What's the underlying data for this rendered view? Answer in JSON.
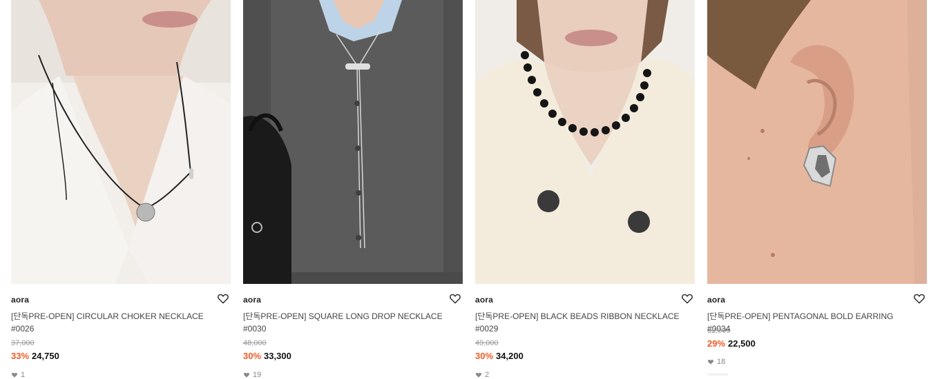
{
  "products": [
    {
      "brand": "aora",
      "name": "[단독PRE-OPEN] CIRCULAR CHOKER NECKLACE #0026",
      "original_price": "37,000",
      "discount": "33%",
      "sale_price": "24,750",
      "likes": "1",
      "image_icon": "necklace-photo"
    },
    {
      "brand": "aora",
      "name": "[단독PRE-OPEN] SQUARE LONG DROP NECKLACE #0030",
      "original_price": "48,000",
      "discount": "30%",
      "sale_price": "33,300",
      "likes": "19",
      "image_icon": "necklace-photo"
    },
    {
      "brand": "aora",
      "name": "[단독PRE-OPEN] BLACK BEADS RIBBON NECKLACE #0029",
      "original_price": "49,000",
      "discount": "30%",
      "sale_price": "34,200",
      "likes": "2",
      "image_icon": "necklace-photo"
    },
    {
      "brand": "aora",
      "name": "[단독PRE-OPEN] PENTAGONAL BOLD EARRING #0034",
      "original_price": "32,000",
      "discount": "29%",
      "sale_price": "22,500",
      "likes": "18",
      "image_icon": "earring-photo"
    }
  ],
  "colors": {
    "discount": "#f15a24",
    "original_price": "#9a9a9a",
    "text": "#222222"
  }
}
